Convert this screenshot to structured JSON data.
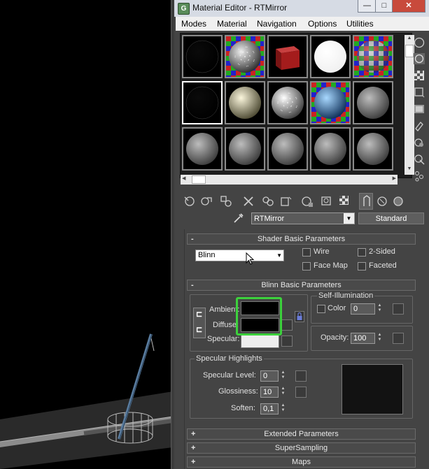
{
  "window": {
    "app_icon": "max-g-icon",
    "title": "Material Editor - RTMirror",
    "min_label": "—",
    "max_label": "□",
    "close_label": "✕"
  },
  "menu": [
    "Modes",
    "Material",
    "Navigation",
    "Options",
    "Utilities"
  ],
  "slots": [
    [
      {
        "kind": "black"
      },
      {
        "kind": "checker-gray"
      },
      {
        "kind": "red-cube"
      },
      {
        "kind": "white"
      },
      {
        "kind": "checker-color"
      }
    ],
    [
      {
        "kind": "black"
      },
      {
        "kind": "cream"
      },
      {
        "kind": "speckle"
      },
      {
        "kind": "blue-checker"
      },
      {
        "kind": "gray"
      }
    ],
    [
      {
        "kind": "gray"
      },
      {
        "kind": "gray"
      },
      {
        "kind": "gray"
      },
      {
        "kind": "gray"
      },
      {
        "kind": "gray"
      }
    ]
  ],
  "icons": {
    "side": [
      "sample-type-sphere-icon",
      "backlight-icon",
      "background-checker-icon",
      "sample-uv-tiling-icon",
      "video-color-check-icon",
      "make-preview-icon",
      "options-icon",
      "select-by-material-icon",
      "material-map-navigator-icon"
    ],
    "toolbar": [
      "get-material-icon",
      "put-to-scene-icon",
      "assign-to-selection-icon",
      "reset-map-icon",
      "make-unique-icon",
      "put-to-library-icon",
      "material-id-channel-icon",
      "show-map-in-viewport-icon",
      "show-end-result-icon",
      "go-to-parent-icon",
      "go-forward-sibling-icon"
    ]
  },
  "material_name": "RTMirror",
  "material_type": "Standard",
  "shader_basic": {
    "header": "Shader Basic Parameters",
    "sign": "-",
    "shader": "Blinn",
    "wire": "Wire",
    "two_sided": "2-Sided",
    "face_map": "Face Map",
    "faceted": "Faceted"
  },
  "blinn_basic": {
    "header": "Blinn Basic Parameters",
    "sign": "-",
    "ambient": "Ambient:",
    "diffuse": "Diffuse:",
    "specular": "Specular:",
    "self_illum": "Self-Illumination",
    "color": "Color",
    "color_value": "0",
    "opacity_label": "Opacity:",
    "opacity_value": "100",
    "colors": {
      "ambient": "#000000",
      "diffuse": "#000000",
      "specular": "#eeeeee"
    }
  },
  "specular_highlights": {
    "title": "Specular Highlights",
    "level_label": "Specular Level:",
    "level_value": "0",
    "gloss_label": "Glossiness:",
    "gloss_value": "10",
    "soften_label": "Soften:",
    "soften_value": "0,1"
  },
  "collapsed": [
    {
      "sign": "+",
      "label": "Extended Parameters"
    },
    {
      "sign": "+",
      "label": "SuperSampling"
    },
    {
      "sign": "+",
      "label": "Maps"
    }
  ],
  "highlight_color": "#3cd23c"
}
